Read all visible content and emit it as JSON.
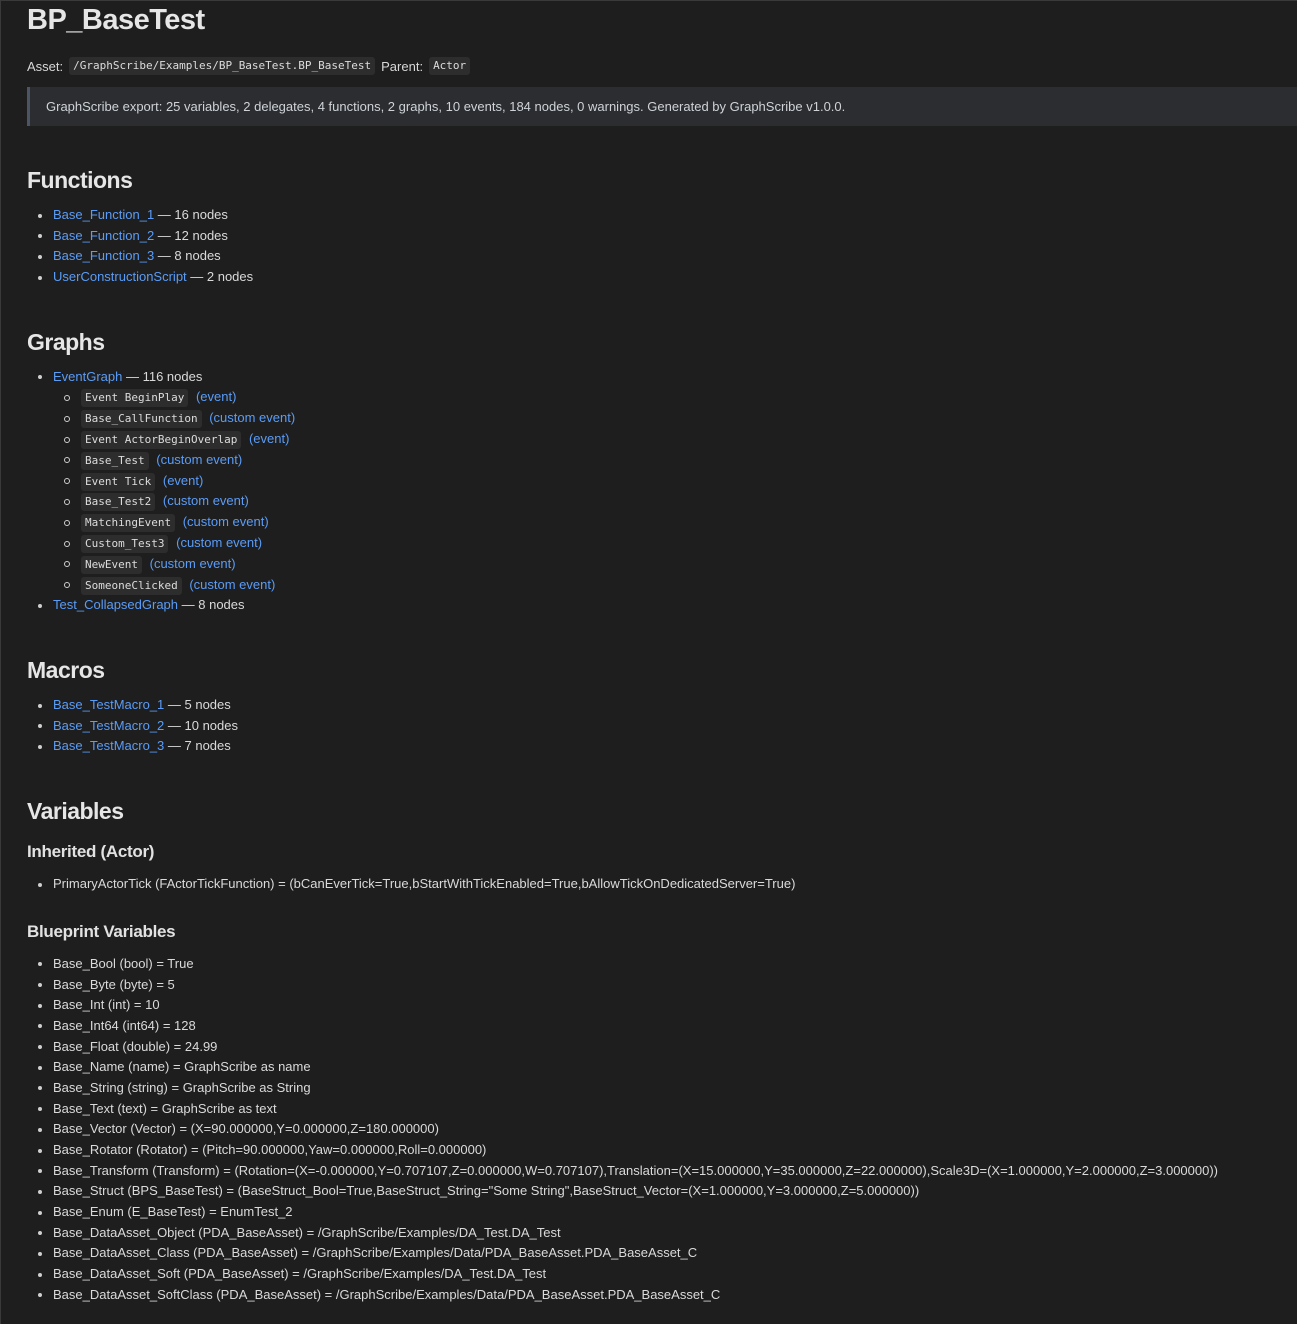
{
  "title": "BP_BaseTest",
  "meta": {
    "asset_label": "Asset:",
    "asset_path": "/GraphScribe/Examples/BP_BaseTest.BP_BaseTest",
    "parent_label": "Parent:",
    "parent_value": "Actor"
  },
  "summary": "GraphScribe export: 25 variables, 2 delegates, 4 functions, 2 graphs, 10 events, 184 nodes, 0 warnings. Generated by GraphScribe v1.0.0.",
  "functions": {
    "heading": "Functions",
    "items": [
      {
        "name": "Base_Function_1",
        "suffix": " — 16 nodes"
      },
      {
        "name": "Base_Function_2",
        "suffix": " — 12 nodes"
      },
      {
        "name": "Base_Function_3",
        "suffix": " — 8 nodes"
      },
      {
        "name": "UserConstructionScript",
        "suffix": " — 2 nodes"
      }
    ]
  },
  "graphs": {
    "heading": "Graphs",
    "event_graph": {
      "name": "EventGraph",
      "suffix": " — 116 nodes"
    },
    "events": [
      {
        "name": "Event BeginPlay",
        "kind": "(event)"
      },
      {
        "name": "Base_CallFunction",
        "kind": "(custom event)"
      },
      {
        "name": "Event ActorBeginOverlap",
        "kind": "(event)"
      },
      {
        "name": "Base_Test",
        "kind": "(custom event)"
      },
      {
        "name": "Event Tick",
        "kind": "(event)"
      },
      {
        "name": "Base_Test2",
        "kind": "(custom event)"
      },
      {
        "name": "MatchingEvent",
        "kind": "(custom event)"
      },
      {
        "name": "Custom_Test3",
        "kind": "(custom event)"
      },
      {
        "name": "NewEvent",
        "kind": "(custom event)"
      },
      {
        "name": "SomeoneClicked",
        "kind": "(custom event)"
      }
    ],
    "collapsed_graph": {
      "name": "Test_CollapsedGraph",
      "suffix": " — 8 nodes"
    }
  },
  "macros": {
    "heading": "Macros",
    "items": [
      {
        "name": "Base_TestMacro_1",
        "suffix": " — 5 nodes"
      },
      {
        "name": "Base_TestMacro_2",
        "suffix": " — 10 nodes"
      },
      {
        "name": "Base_TestMacro_3",
        "suffix": " — 7 nodes"
      }
    ]
  },
  "variables": {
    "heading": "Variables",
    "inherited_heading": "Inherited (Actor)",
    "inherited": [
      "PrimaryActorTick (FActorTickFunction) = (bCanEverTick=True,bStartWithTickEnabled=True,bAllowTickOnDedicatedServer=True)"
    ],
    "blueprint_heading": "Blueprint Variables",
    "blueprint": [
      "Base_Bool (bool) = True",
      "Base_Byte (byte) = 5",
      "Base_Int (int) = 10",
      "Base_Int64 (int64) = 128",
      "Base_Float (double) = 24.99",
      "Base_Name (name) = GraphScribe as name",
      "Base_String (string) = GraphScribe as String",
      "Base_Text (text) = GraphScribe as text",
      "Base_Vector (Vector) = (X=90.000000,Y=0.000000,Z=180.000000)",
      "Base_Rotator (Rotator) = (Pitch=90.000000,Yaw=0.000000,Roll=0.000000)",
      "Base_Transform (Transform) = (Rotation=(X=-0.000000,Y=0.707107,Z=0.000000,W=0.707107),Translation=(X=15.000000,Y=35.000000,Z=22.000000),Scale3D=(X=1.000000,Y=2.000000,Z=3.000000))",
      "Base_Struct (BPS_BaseTest) = (BaseStruct_Bool=True,BaseStruct_String=\"Some String\",BaseStruct_Vector=(X=1.000000,Y=3.000000,Z=5.000000))",
      "Base_Enum (E_BaseTest) = EnumTest_2",
      "Base_DataAsset_Object (PDA_BaseAsset) = /GraphScribe/Examples/DA_Test.DA_Test",
      "Base_DataAsset_Class (PDA_BaseAsset) = /GraphScribe/Examples/Data/PDA_BaseAsset.PDA_BaseAsset_C",
      "Base_DataAsset_Soft (PDA_BaseAsset) = /GraphScribe/Examples/DA_Test.DA_Test",
      "Base_DataAsset_SoftClass (PDA_BaseAsset) = /GraphScribe/Examples/Data/PDA_BaseAsset.PDA_BaseAsset_C"
    ]
  }
}
